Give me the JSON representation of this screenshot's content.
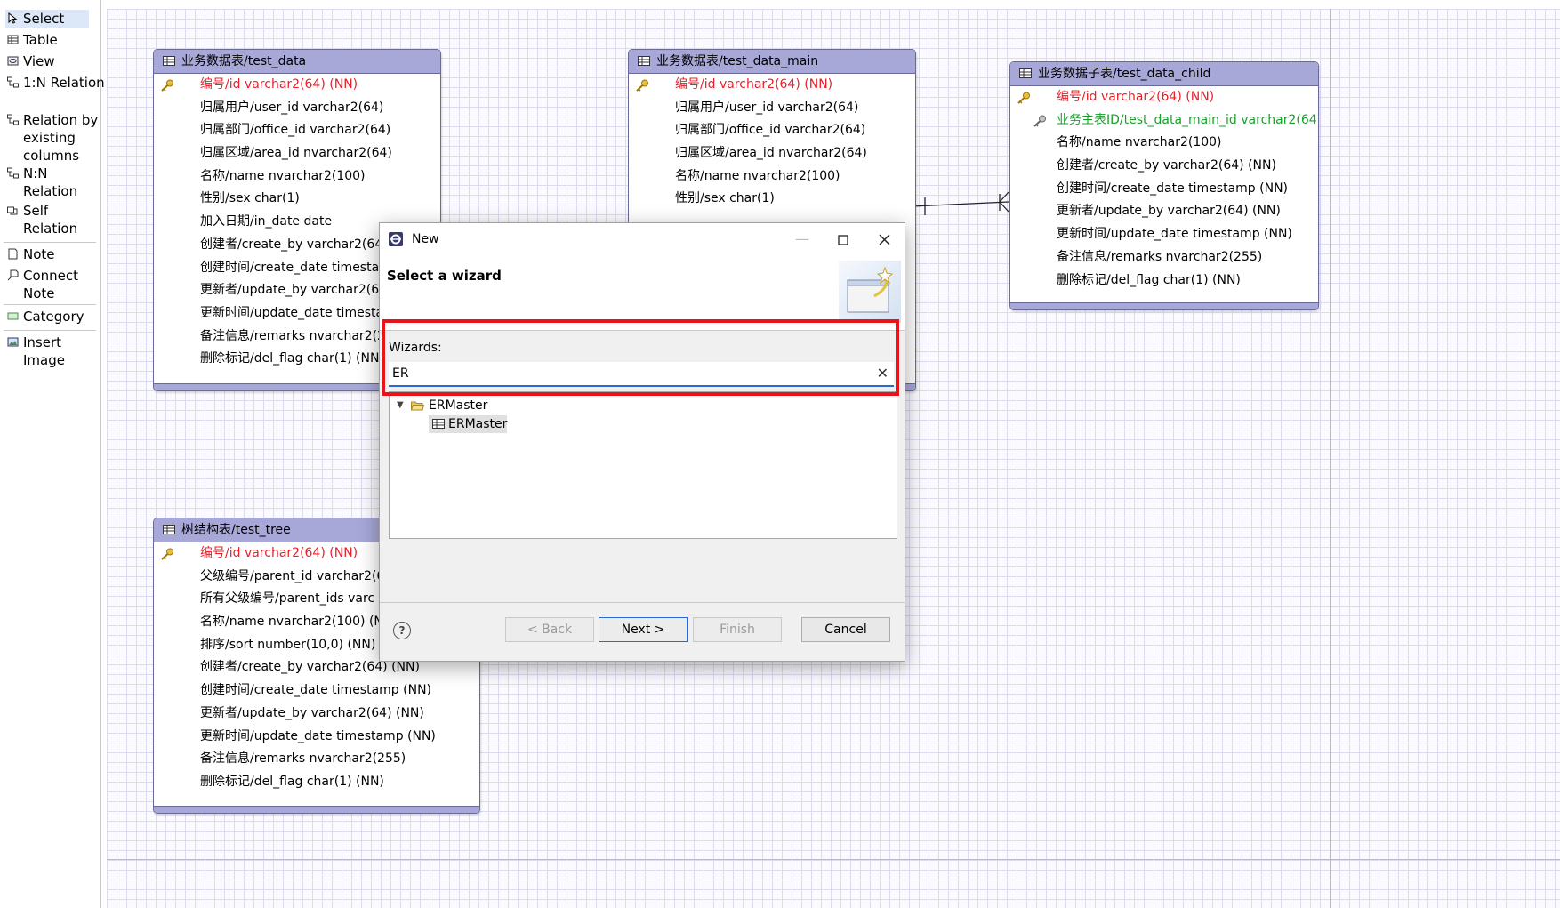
{
  "palette": {
    "items": [
      {
        "label": "Select",
        "icon": "pointer-icon"
      },
      {
        "label": "Table",
        "icon": "table-icon"
      },
      {
        "label": "View",
        "icon": "view-icon"
      },
      {
        "label": "1:N Relation",
        "icon": "relation-icon"
      },
      {
        "label": "Relation by existing columns",
        "icon": "relation-icon"
      },
      {
        "label": "N:N Relation",
        "icon": "relation-icon"
      },
      {
        "label": "Self Relation",
        "icon": "self-relation-icon"
      },
      {
        "label": "Note",
        "icon": "note-icon"
      },
      {
        "label": "Connect Note",
        "icon": "connect-note-icon"
      },
      {
        "label": "Category",
        "icon": "category-icon"
      },
      {
        "label": "Insert Image",
        "icon": "image-icon"
      }
    ]
  },
  "tables": {
    "test_data": {
      "title": "业务数据表/test_data",
      "columns": [
        "编号/id varchar2(64) (NN)",
        "归属用户/user_id varchar2(64)",
        "归属部门/office_id varchar2(64)",
        "归属区域/area_id nvarchar2(64)",
        "名称/name nvarchar2(100)",
        "性别/sex char(1)",
        "加入日期/in_date date",
        "创建者/create_by varchar2(64)",
        "创建时间/create_date timestam",
        "更新者/update_by varchar2(64",
        "更新时间/update_date timesta",
        "备注信息/remarks nvarchar2(2",
        "删除标记/del_flag char(1) (NN"
      ]
    },
    "test_data_main": {
      "title": "业务数据表/test_data_main",
      "columns": [
        "编号/id varchar2(64) (NN)",
        "归属用户/user_id varchar2(64)",
        "归属部门/office_id varchar2(64)",
        "归属区域/area_id nvarchar2(64)",
        "名称/name nvarchar2(100)",
        "性别/sex char(1)"
      ]
    },
    "test_data_child": {
      "title": "业务数据子表/test_data_child",
      "columns": [
        "编号/id varchar2(64) (NN)",
        "业务主表ID/test_data_main_id varchar2(64)",
        "名称/name nvarchar2(100)",
        "创建者/create_by varchar2(64) (NN)",
        "创建时间/create_date timestamp (NN)",
        "更新者/update_by varchar2(64) (NN)",
        "更新时间/update_date timestamp (NN)",
        "备注信息/remarks nvarchar2(255)",
        "删除标记/del_flag char(1) (NN)"
      ]
    },
    "test_tree": {
      "title": "树结构表/test_tree",
      "columns": [
        "编号/id varchar2(64) (NN)",
        "父级编号/parent_id varchar2(6",
        "所有父级编号/parent_ids varc",
        "名称/name nvarchar2(100) (NN",
        "排序/sort number(10,0) (NN)",
        "创建者/create_by varchar2(64) (NN)",
        "创建时间/create_date timestamp (NN)",
        "更新者/update_by varchar2(64) (NN)",
        "更新时间/update_date timestamp (NN)",
        "备注信息/remarks nvarchar2(255)",
        "删除标记/del_flag char(1) (NN)"
      ]
    }
  },
  "dialog": {
    "title": "New",
    "heading": "Select a wizard",
    "wizards_label": "Wizards:",
    "filter_value": "ER",
    "clear_icon": "✕",
    "tree": {
      "category": "ERMaster",
      "wizard": "ERMaster"
    },
    "buttons": {
      "back": "< Back",
      "next": "Next >",
      "finish": "Finish",
      "cancel": "Cancel"
    },
    "help": "?",
    "highlight_color": "#e8141a"
  },
  "colors": {
    "primary_key": "#e8202a",
    "foreign_key": "#1a9e2a",
    "entity_header": "#a8a8d8"
  }
}
